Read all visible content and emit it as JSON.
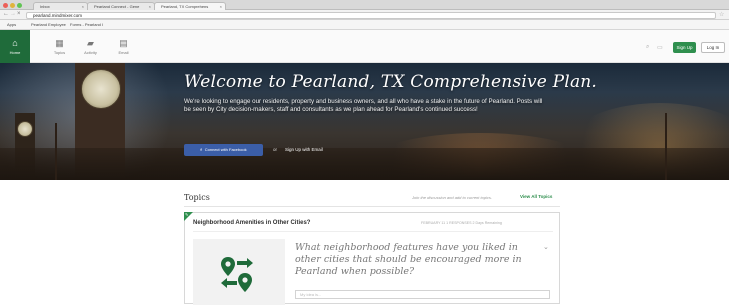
{
  "browser": {
    "tabs": [
      {
        "label": "Inbox"
      },
      {
        "label": "Pearland Connect - Gene"
      },
      {
        "label": "Pearland, TX Comprehens"
      }
    ],
    "url": "pearland.mindmixer.com",
    "bookmarks": [
      "Apps",
      "Pearland Employee",
      "Forms - Pearland I"
    ]
  },
  "nav": {
    "items": [
      {
        "label": "Home",
        "icon": "house-icon"
      },
      {
        "label": "Topics",
        "icon": "topics-icon"
      },
      {
        "label": "Activity",
        "icon": "activity-icon"
      },
      {
        "label": "Email",
        "icon": "email-icon"
      }
    ],
    "signup_label": "Sign Up",
    "login_label": "Log In"
  },
  "hero": {
    "title": "Welcome to Pearland, TX Comprehensive Plan.",
    "text": "We're looking to engage our residents, property and business owners, and all who have a stake in the future of Pearland. Posts will be seen by City decision-makers, staff and consultants as we plan ahead for Pearland's continued success!",
    "facebook_label": "Connect with Facebook",
    "or": "or",
    "email_label": "Sign Up with Email"
  },
  "topics": {
    "title": "Topics",
    "note": "Join the discussion and add to current topics.",
    "view_all": "View All Topics",
    "card": {
      "title": "Neighborhood Amenities in Other Cities?",
      "meta": "FEBRUARY 11   1 RESPONSES   2 Days Remaining",
      "question": "What neighborhood features have you liked in other cities that should be encouraged more in Pearland when possible?",
      "answer_placeholder": "My idea is..."
    }
  },
  "colors": {
    "brand_green": "#2f8f4e",
    "home_green": "#1f6b3a",
    "facebook_blue": "#3b5ea8"
  }
}
